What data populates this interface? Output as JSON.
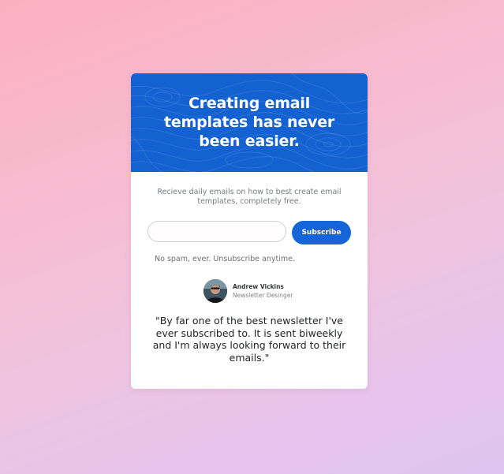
{
  "card": {
    "headline": "Creating email templates has never been easier.",
    "intro": "Recieve daily emails on how to best create email templates, completely free.",
    "email_input": {
      "value": "",
      "placeholder": ""
    },
    "subscribe_label": "Subscribe",
    "spam_note": "No spam, ever. Unsubscribe anytime.",
    "testimonial": {
      "author_name": "Andrew Vickins",
      "author_role": "Newsletter Desinger",
      "quote": "\"By far one of the best newsletter I've ever subscribed to. It is sent biweekly and I'm always looking forward to their emails.\""
    }
  },
  "colors": {
    "header_blue": "#1462d2",
    "button_blue": "#1565d8",
    "background_start": "#fbb0bf",
    "background_end": "#ddc4f1"
  },
  "icons": {
    "avatar": "person-avatar"
  }
}
